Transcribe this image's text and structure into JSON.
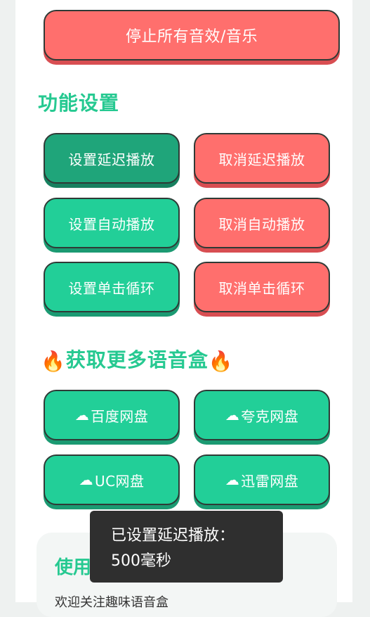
{
  "top": {
    "stop_all_label": "停止所有音效/音乐"
  },
  "function_settings": {
    "title": "功能设置",
    "buttons": {
      "set_delay": "设置延迟播放",
      "cancel_delay": "取消延迟播放",
      "set_auto": "设置自动播放",
      "cancel_auto": "取消自动播放",
      "set_loop": "设置单击循环",
      "cancel_loop": "取消单击循环"
    }
  },
  "more_boxes": {
    "title": "获取更多语音盒",
    "fire_icon": "🔥",
    "cloud_icon": "☁",
    "links": {
      "baidu": "百度网盘",
      "quark": "夸克网盘",
      "uc": "UC网盘",
      "xunlei": "迅雷网盘"
    }
  },
  "usage": {
    "title": "使用",
    "welcome_text": "欢迎关注趣味语音盒"
  },
  "toast": {
    "line1": "已设置延迟播放：",
    "line2": "500毫秒"
  },
  "colors": {
    "accent_green": "#22cf98",
    "red": "#ff6f6d",
    "dark_green": "#1fa57a"
  }
}
